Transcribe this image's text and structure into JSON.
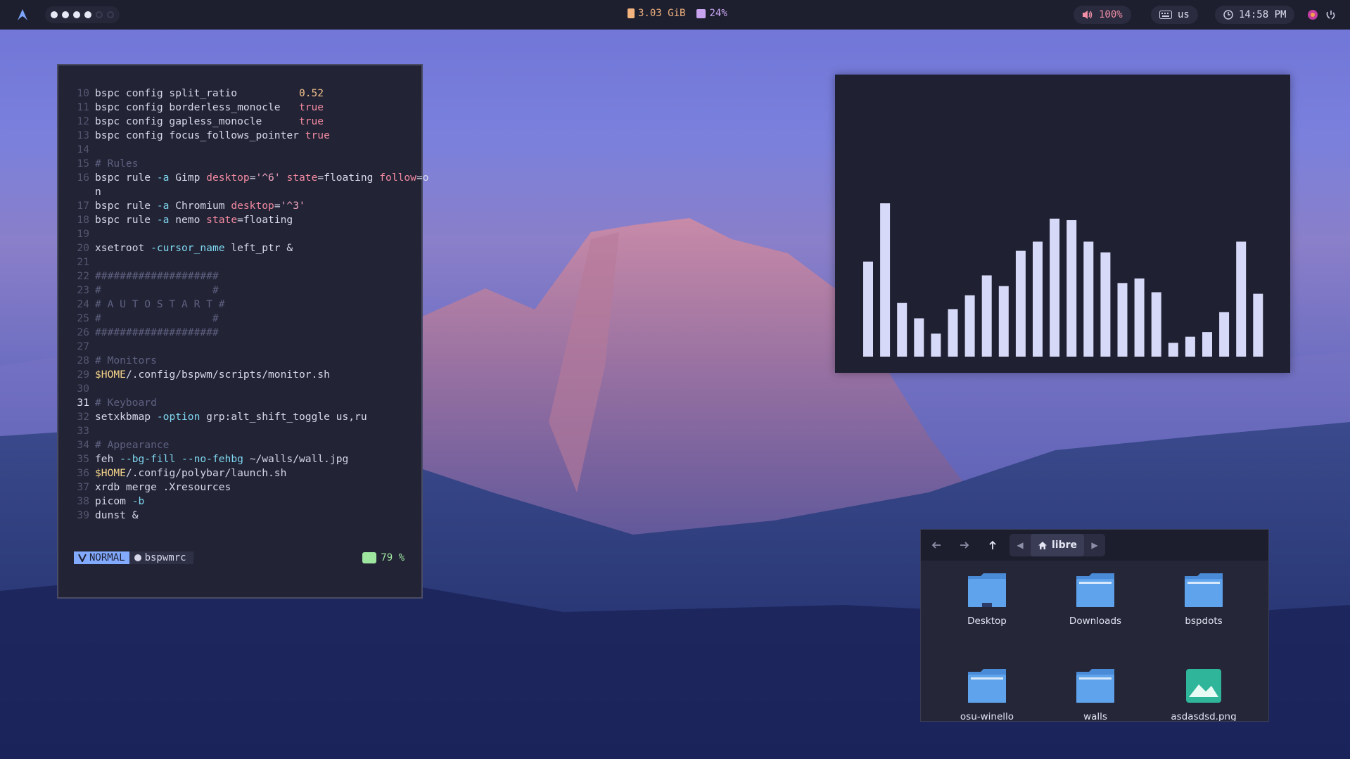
{
  "topbar": {
    "workspaces": [
      {
        "state": "occupied"
      },
      {
        "state": "occupied"
      },
      {
        "state": "occupied"
      },
      {
        "state": "occupied"
      },
      {
        "state": "empty"
      },
      {
        "state": "empty"
      }
    ],
    "memory": "3.03 GiB",
    "cpu": "24%",
    "volume": "100%",
    "keyboard_layout": "us",
    "clock": "14:58 PM",
    "colors": {
      "bar": "#1e1f2e",
      "memory": "#f2b37e",
      "cpu": "#c8a4f0",
      "volume": "#f28fa8"
    }
  },
  "terminal": {
    "current_line": "31",
    "mode": "NORMAL",
    "filename": "bspwmrc",
    "percent": "79 %"
  },
  "visualizer": {
    "bar_levels": [
      0.62,
      1.0,
      0.35,
      0.25,
      0.15,
      0.31,
      0.4,
      0.53,
      0.46,
      0.69,
      0.75,
      0.9,
      0.89,
      0.75,
      0.68,
      0.48,
      0.51,
      0.42,
      0.09,
      0.13,
      0.16,
      0.29,
      0.75,
      0.41
    ],
    "bar_color": "#d6d9f7"
  },
  "file_manager": {
    "current_folder": "libre",
    "items": [
      {
        "label": "Desktop",
        "icon": "folder-desktop-icon"
      },
      {
        "label": "Downloads",
        "icon": "folder-icon"
      },
      {
        "label": "bspdots",
        "icon": "folder-icon"
      },
      {
        "label": "osu-winello",
        "icon": "folder-icon"
      },
      {
        "label": "walls",
        "icon": "folder-icon"
      },
      {
        "label": "asdasdsd.png",
        "icon": "image-file-icon"
      }
    ]
  }
}
